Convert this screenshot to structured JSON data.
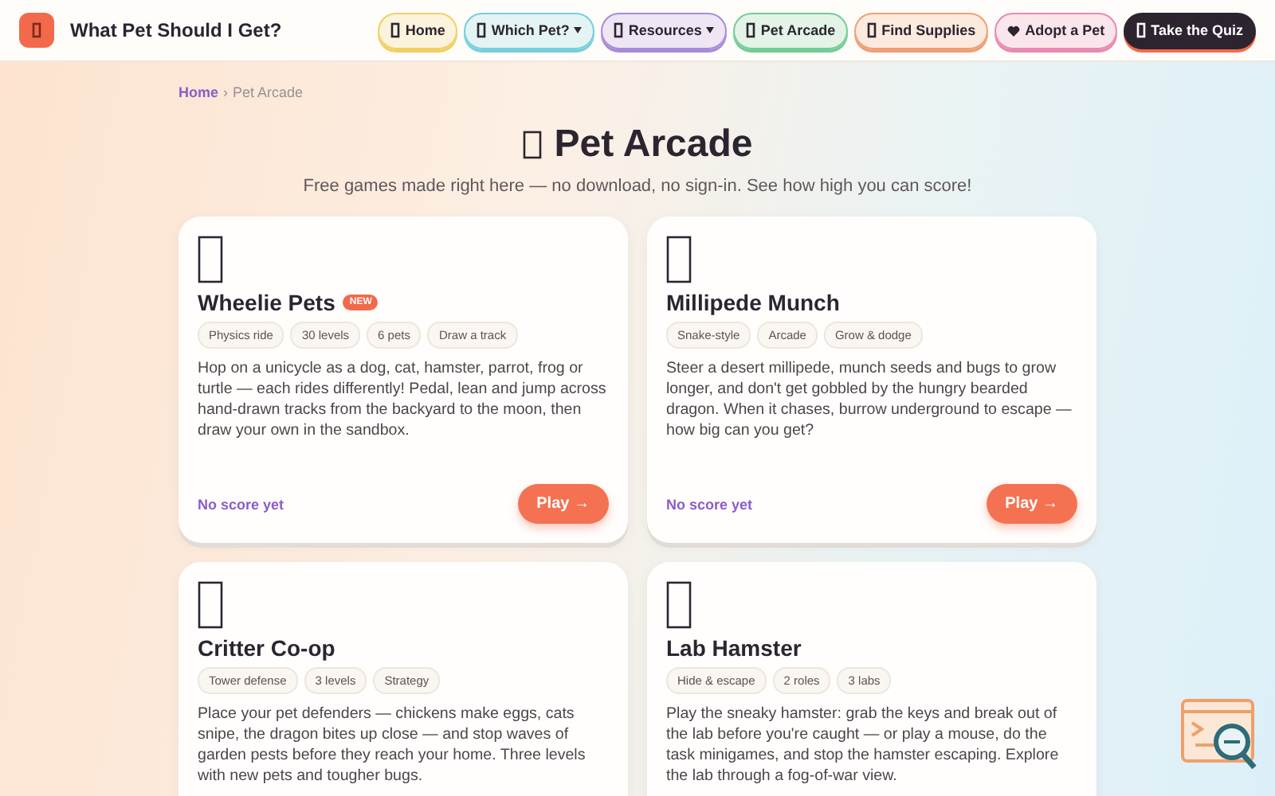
{
  "header": {
    "brand": "What Pet Should I Get?",
    "nav": [
      {
        "label": "Home",
        "color": "#f2cf63",
        "dropdown": false,
        "kind": "pill"
      },
      {
        "label": "Which Pet?",
        "color": "#76cfdc",
        "dropdown": true,
        "kind": "pill"
      },
      {
        "label": "Resources",
        "color": "#a98ad9",
        "dropdown": true,
        "kind": "pill"
      },
      {
        "label": "Pet Arcade",
        "color": "#72cc98",
        "dropdown": false,
        "kind": "pill"
      },
      {
        "label": "Find Supplies",
        "color": "#ee9f74",
        "dropdown": false,
        "kind": "pill"
      },
      {
        "label": "Adopt a Pet",
        "color": "#e889b0",
        "dropdown": false,
        "kind": "heart"
      },
      {
        "label": "Take the Quiz",
        "color": "#2c2530",
        "dropdown": false,
        "kind": "primary"
      }
    ]
  },
  "breadcrumb": {
    "home": "Home",
    "separator": "›",
    "current": "Pet Arcade"
  },
  "hero": {
    "title": "Pet Arcade",
    "subtitle": "Free games made right here — no download, no sign-in. See how high you can score!"
  },
  "games": [
    {
      "title": "Wheelie Pets",
      "badge": "NEW",
      "tags": [
        "Physics ride",
        "30 levels",
        "6 pets",
        "Draw a track"
      ],
      "description": "Hop on a unicycle as a dog, cat, hamster, parrot, frog or turtle — each rides differently! Pedal, lean and jump across hand-drawn tracks from the backyard to the moon, then draw your own in the sandbox.",
      "score": "No score yet",
      "action": "Play →"
    },
    {
      "title": "Millipede Munch",
      "tags": [
        "Snake-style",
        "Arcade",
        "Grow & dodge"
      ],
      "description": "Steer a desert millipede, munch seeds and bugs to grow longer, and don't get gobbled by the hungry bearded dragon. When it chases, burrow underground to escape — how big can you get?",
      "score": "No score yet",
      "action": "Play →"
    },
    {
      "title": "Critter Co-op",
      "tags": [
        "Tower defense",
        "3 levels",
        "Strategy"
      ],
      "description": "Place your pet defenders — chickens make eggs, cats snipe, the dragon bites up close — and stop waves of garden pests before they reach your home. Three levels with new pets and tougher bugs."
    },
    {
      "title": "Lab Hamster",
      "tags": [
        "Hide & escape",
        "2 roles",
        "3 labs"
      ],
      "description": "Play the sneaky hamster: grab the keys and break out of the lab before you're caught — or play a mouse, do the task minigames, and stop the hamster escaping. Explore the lab through a fog-of-war view."
    }
  ]
}
